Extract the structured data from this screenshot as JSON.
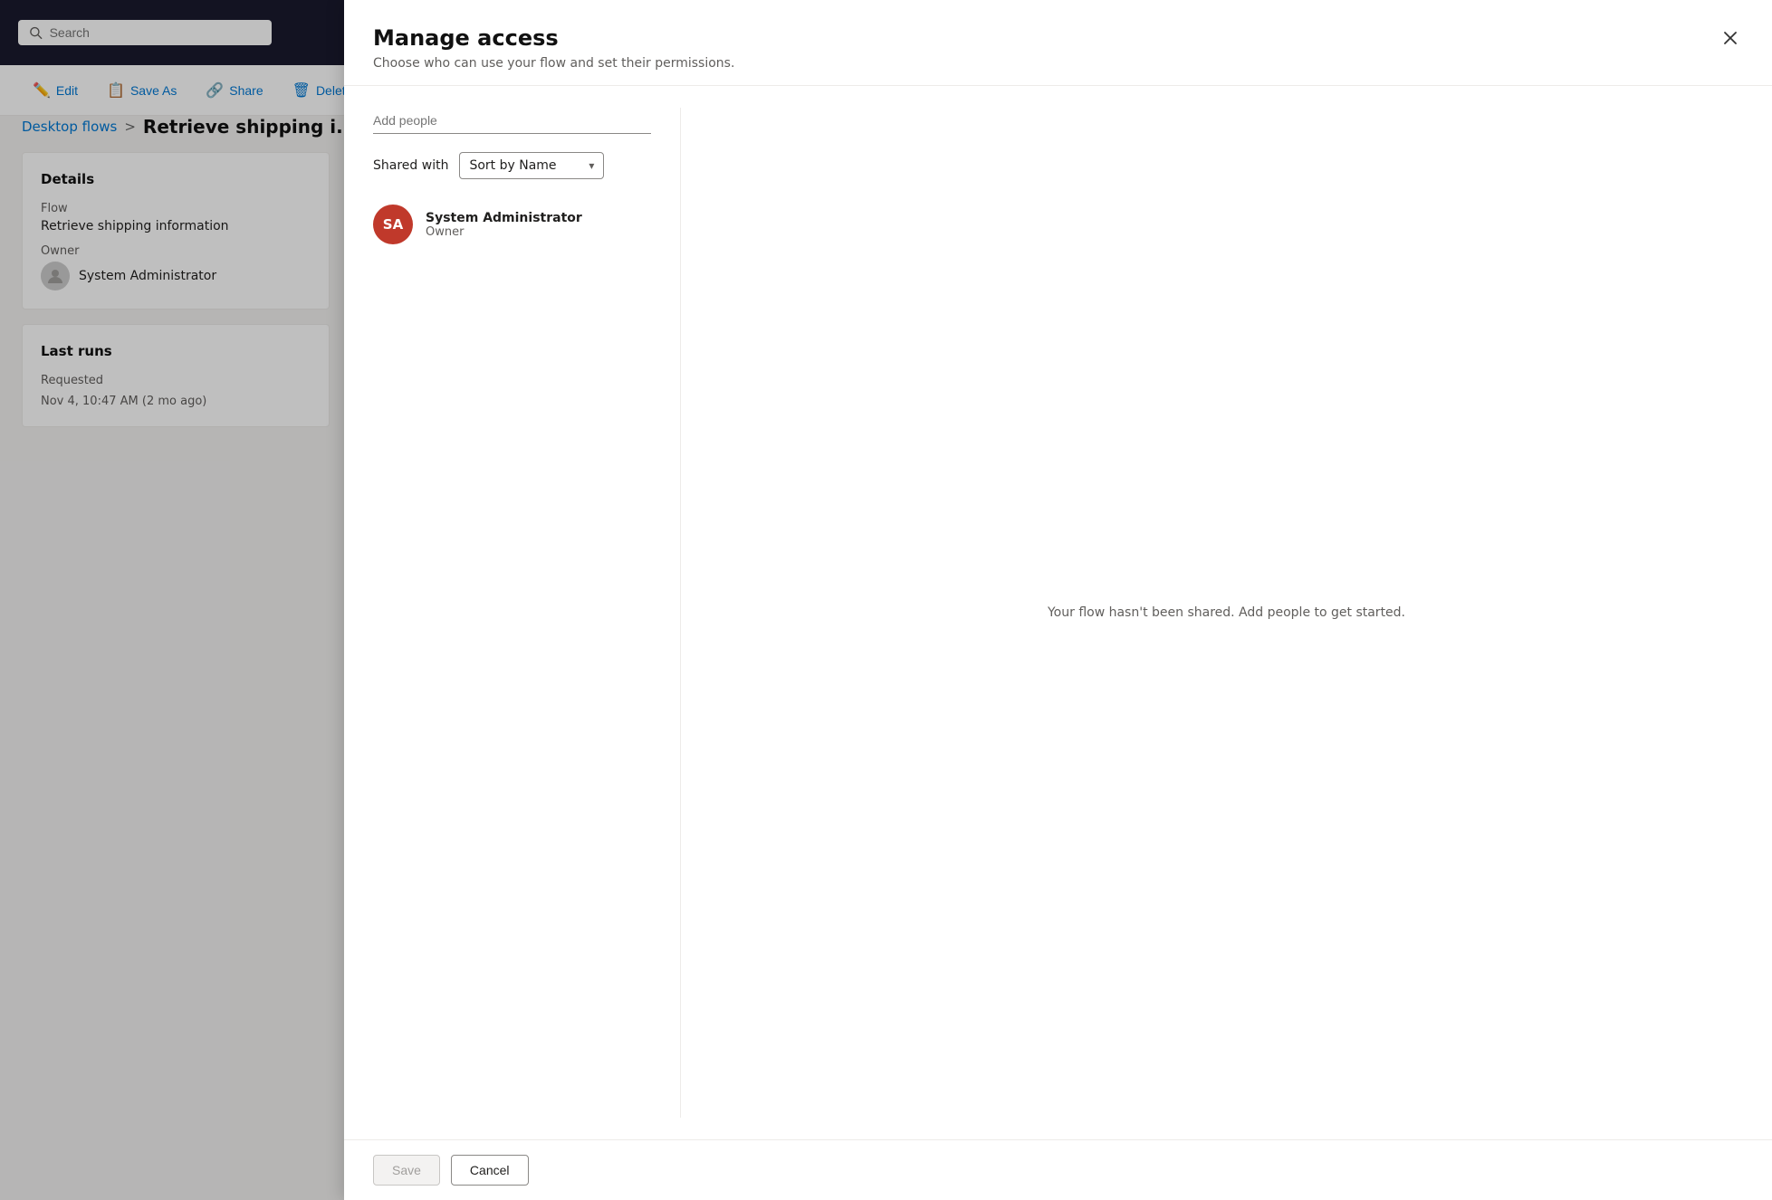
{
  "topbar": {
    "search_placeholder": "Search"
  },
  "toolbar": {
    "edit_label": "Edit",
    "save_as_label": "Save As",
    "share_label": "Share",
    "delete_label": "Delete"
  },
  "breadcrumb": {
    "parent_label": "Desktop flows",
    "separator": ">",
    "current_label": "Retrieve shipping i..."
  },
  "details_card": {
    "title": "Details",
    "flow_label": "Flow",
    "flow_value": "Retrieve shipping information",
    "owner_label": "Owner",
    "owner_name": "System Administrator"
  },
  "last_runs_card": {
    "title": "Last runs",
    "status_label": "Requested",
    "run_time": "Nov 4, 10:47 AM (2 mo ago)"
  },
  "modal": {
    "title": "Manage access",
    "subtitle": "Choose who can use your flow and set their permissions.",
    "add_people_placeholder": "Add people",
    "shared_with_label": "Shared with",
    "sort_label": "Sort by Name",
    "user_initials": "SA",
    "user_name": "System Administrator",
    "user_role": "Owner",
    "empty_message": "Your flow hasn't been shared. Add people to get started.",
    "save_label": "Save",
    "cancel_label": "Cancel"
  }
}
